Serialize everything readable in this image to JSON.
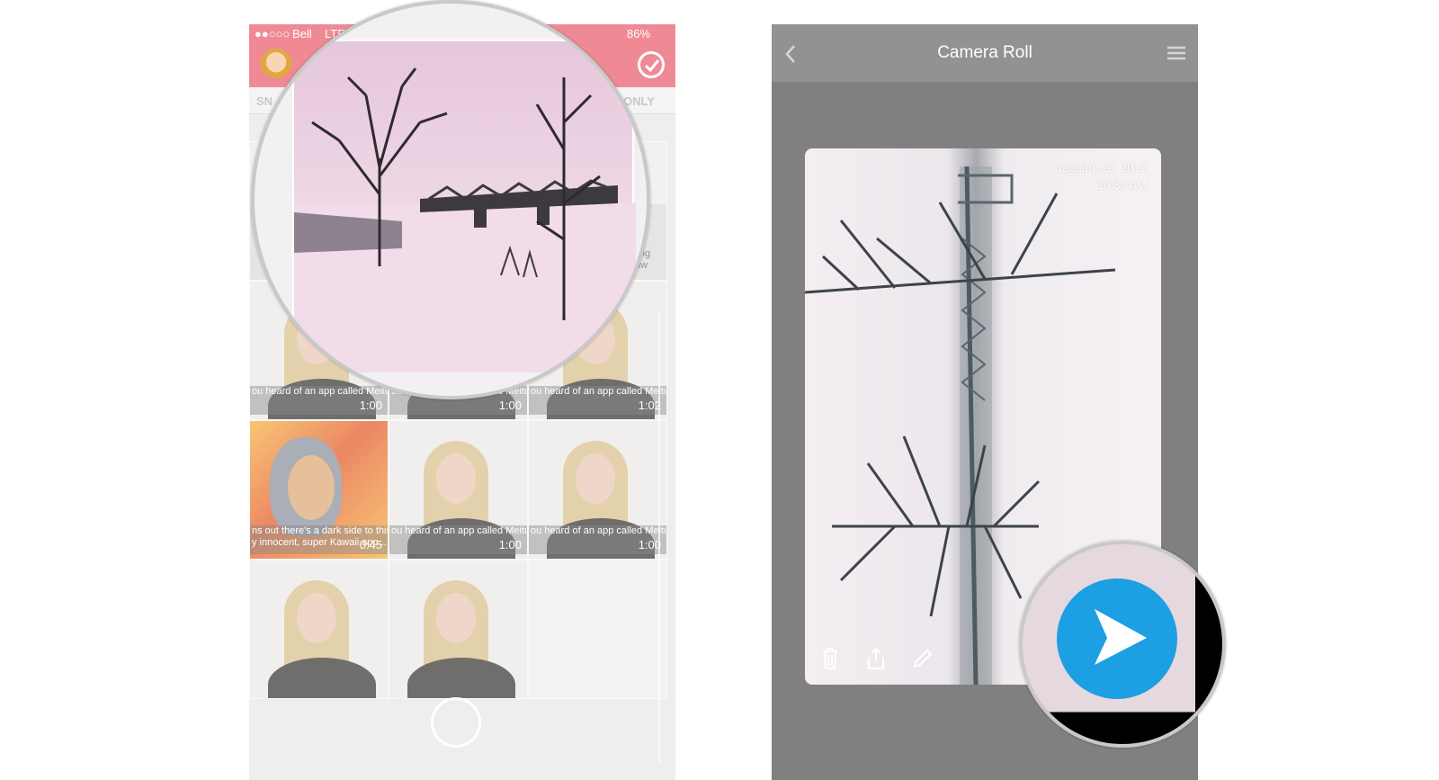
{
  "left_screen": {
    "status_bar": {
      "signal": "●●○○○",
      "carrier": "Bell",
      "network": "LTE",
      "battery": "86%"
    },
    "tabs": {
      "left_partial": "SN",
      "right_partial": "ONLY"
    },
    "grid": [
      {
        "type": "snow"
      },
      {
        "type": "snow"
      },
      {
        "type": "snow"
      },
      {
        "type": "video",
        "caption": "ou heard of an app called Meitu?",
        "duration": "1:00"
      },
      {
        "type": "video",
        "caption": "ou heard of an app called Meitu?",
        "duration": "1:00"
      },
      {
        "type": "video",
        "caption": "ou heard of an app called Meitu?",
        "duration": "1:02"
      },
      {
        "type": "cartoon",
        "caption_line1": "ns out there's a dark side to this",
        "caption_line2": "y innocent, super Kawaii app...",
        "duration": "0:45"
      },
      {
        "type": "video",
        "caption": "ou heard of an app called Meitu?",
        "duration": "1:00"
      },
      {
        "type": "video",
        "caption": "ou heard of an app called Meitu?",
        "duration": "1:00"
      },
      {
        "type": "video"
      },
      {
        "type": "video"
      },
      {
        "type": "empty"
      }
    ],
    "partial_side_text": [
      "ling",
      "ow"
    ]
  },
  "right_screen": {
    "title": "Camera Roll",
    "photo_date": "January 20, 2017",
    "photo_time": "10:39 AM"
  },
  "colors": {
    "header_pink": "#ef8a95",
    "nav_gray": "#929292",
    "send_blue": "#1c9fe3"
  },
  "icons": {
    "back": "chevron-left-icon",
    "menu": "hamburger-icon",
    "delete": "trash-icon",
    "share": "share-icon",
    "edit": "pencil-icon",
    "send": "send-arrow-icon",
    "select": "check-circle-icon"
  }
}
